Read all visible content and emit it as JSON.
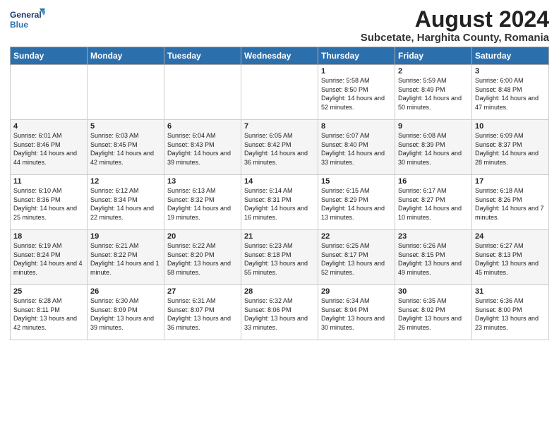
{
  "logo": {
    "line1": "General",
    "line2": "Blue"
  },
  "title": "August 2024",
  "subtitle": "Subcetate, Harghita County, Romania",
  "headers": [
    "Sunday",
    "Monday",
    "Tuesday",
    "Wednesday",
    "Thursday",
    "Friday",
    "Saturday"
  ],
  "weeks": [
    [
      {
        "day": "",
        "sunrise": "",
        "sunset": "",
        "daylight": ""
      },
      {
        "day": "",
        "sunrise": "",
        "sunset": "",
        "daylight": ""
      },
      {
        "day": "",
        "sunrise": "",
        "sunset": "",
        "daylight": ""
      },
      {
        "day": "",
        "sunrise": "",
        "sunset": "",
        "daylight": ""
      },
      {
        "day": "1",
        "sunrise": "Sunrise: 5:58 AM",
        "sunset": "Sunset: 8:50 PM",
        "daylight": "Daylight: 14 hours and 52 minutes."
      },
      {
        "day": "2",
        "sunrise": "Sunrise: 5:59 AM",
        "sunset": "Sunset: 8:49 PM",
        "daylight": "Daylight: 14 hours and 50 minutes."
      },
      {
        "day": "3",
        "sunrise": "Sunrise: 6:00 AM",
        "sunset": "Sunset: 8:48 PM",
        "daylight": "Daylight: 14 hours and 47 minutes."
      }
    ],
    [
      {
        "day": "4",
        "sunrise": "Sunrise: 6:01 AM",
        "sunset": "Sunset: 8:46 PM",
        "daylight": "Daylight: 14 hours and 44 minutes."
      },
      {
        "day": "5",
        "sunrise": "Sunrise: 6:03 AM",
        "sunset": "Sunset: 8:45 PM",
        "daylight": "Daylight: 14 hours and 42 minutes."
      },
      {
        "day": "6",
        "sunrise": "Sunrise: 6:04 AM",
        "sunset": "Sunset: 8:43 PM",
        "daylight": "Daylight: 14 hours and 39 minutes."
      },
      {
        "day": "7",
        "sunrise": "Sunrise: 6:05 AM",
        "sunset": "Sunset: 8:42 PM",
        "daylight": "Daylight: 14 hours and 36 minutes."
      },
      {
        "day": "8",
        "sunrise": "Sunrise: 6:07 AM",
        "sunset": "Sunset: 8:40 PM",
        "daylight": "Daylight: 14 hours and 33 minutes."
      },
      {
        "day": "9",
        "sunrise": "Sunrise: 6:08 AM",
        "sunset": "Sunset: 8:39 PM",
        "daylight": "Daylight: 14 hours and 30 minutes."
      },
      {
        "day": "10",
        "sunrise": "Sunrise: 6:09 AM",
        "sunset": "Sunset: 8:37 PM",
        "daylight": "Daylight: 14 hours and 28 minutes."
      }
    ],
    [
      {
        "day": "11",
        "sunrise": "Sunrise: 6:10 AM",
        "sunset": "Sunset: 8:36 PM",
        "daylight": "Daylight: 14 hours and 25 minutes."
      },
      {
        "day": "12",
        "sunrise": "Sunrise: 6:12 AM",
        "sunset": "Sunset: 8:34 PM",
        "daylight": "Daylight: 14 hours and 22 minutes."
      },
      {
        "day": "13",
        "sunrise": "Sunrise: 6:13 AM",
        "sunset": "Sunset: 8:32 PM",
        "daylight": "Daylight: 14 hours and 19 minutes."
      },
      {
        "day": "14",
        "sunrise": "Sunrise: 6:14 AM",
        "sunset": "Sunset: 8:31 PM",
        "daylight": "Daylight: 14 hours and 16 minutes."
      },
      {
        "day": "15",
        "sunrise": "Sunrise: 6:15 AM",
        "sunset": "Sunset: 8:29 PM",
        "daylight": "Daylight: 14 hours and 13 minutes."
      },
      {
        "day": "16",
        "sunrise": "Sunrise: 6:17 AM",
        "sunset": "Sunset: 8:27 PM",
        "daylight": "Daylight: 14 hours and 10 minutes."
      },
      {
        "day": "17",
        "sunrise": "Sunrise: 6:18 AM",
        "sunset": "Sunset: 8:26 PM",
        "daylight": "Daylight: 14 hours and 7 minutes."
      }
    ],
    [
      {
        "day": "18",
        "sunrise": "Sunrise: 6:19 AM",
        "sunset": "Sunset: 8:24 PM",
        "daylight": "Daylight: 14 hours and 4 minutes."
      },
      {
        "day": "19",
        "sunrise": "Sunrise: 6:21 AM",
        "sunset": "Sunset: 8:22 PM",
        "daylight": "Daylight: 14 hours and 1 minute."
      },
      {
        "day": "20",
        "sunrise": "Sunrise: 6:22 AM",
        "sunset": "Sunset: 8:20 PM",
        "daylight": "Daylight: 13 hours and 58 minutes."
      },
      {
        "day": "21",
        "sunrise": "Sunrise: 6:23 AM",
        "sunset": "Sunset: 8:18 PM",
        "daylight": "Daylight: 13 hours and 55 minutes."
      },
      {
        "day": "22",
        "sunrise": "Sunrise: 6:25 AM",
        "sunset": "Sunset: 8:17 PM",
        "daylight": "Daylight: 13 hours and 52 minutes."
      },
      {
        "day": "23",
        "sunrise": "Sunrise: 6:26 AM",
        "sunset": "Sunset: 8:15 PM",
        "daylight": "Daylight: 13 hours and 49 minutes."
      },
      {
        "day": "24",
        "sunrise": "Sunrise: 6:27 AM",
        "sunset": "Sunset: 8:13 PM",
        "daylight": "Daylight: 13 hours and 45 minutes."
      }
    ],
    [
      {
        "day": "25",
        "sunrise": "Sunrise: 6:28 AM",
        "sunset": "Sunset: 8:11 PM",
        "daylight": "Daylight: 13 hours and 42 minutes."
      },
      {
        "day": "26",
        "sunrise": "Sunrise: 6:30 AM",
        "sunset": "Sunset: 8:09 PM",
        "daylight": "Daylight: 13 hours and 39 minutes."
      },
      {
        "day": "27",
        "sunrise": "Sunrise: 6:31 AM",
        "sunset": "Sunset: 8:07 PM",
        "daylight": "Daylight: 13 hours and 36 minutes."
      },
      {
        "day": "28",
        "sunrise": "Sunrise: 6:32 AM",
        "sunset": "Sunset: 8:06 PM",
        "daylight": "Daylight: 13 hours and 33 minutes."
      },
      {
        "day": "29",
        "sunrise": "Sunrise: 6:34 AM",
        "sunset": "Sunset: 8:04 PM",
        "daylight": "Daylight: 13 hours and 30 minutes."
      },
      {
        "day": "30",
        "sunrise": "Sunrise: 6:35 AM",
        "sunset": "Sunset: 8:02 PM",
        "daylight": "Daylight: 13 hours and 26 minutes."
      },
      {
        "day": "31",
        "sunrise": "Sunrise: 6:36 AM",
        "sunset": "Sunset: 8:00 PM",
        "daylight": "Daylight: 13 hours and 23 minutes."
      }
    ]
  ]
}
